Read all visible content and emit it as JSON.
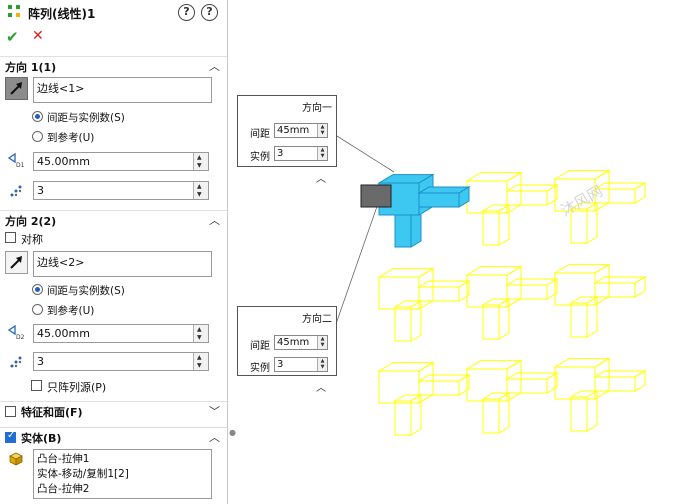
{
  "titlebar": {
    "title": "阵列(线性)1",
    "help1": "?",
    "help2": "?"
  },
  "actions": {
    "ok": "✔",
    "cancel": "✕"
  },
  "direction1": {
    "header": "方向 1(1)",
    "edge": "边线<1>",
    "opt_spacing": "间距与实例数(S)",
    "opt_reference": "到参考(U)",
    "spacing_value": "45.00mm",
    "count_value": "3"
  },
  "direction2": {
    "header": "方向 2(2)",
    "symmetric": "对称",
    "edge": "边线<2>",
    "opt_spacing": "间距与实例数(S)",
    "opt_reference": "到参考(U)",
    "spacing_value": "45.00mm",
    "count_value": "3",
    "seed_only": "只阵列源(P)"
  },
  "features_section": {
    "header": "特征和面(F)"
  },
  "bodies_section": {
    "header": "实体(B)",
    "items": [
      "凸台-拉伸1",
      "实体-移动/复制1[2]",
      "凸台-拉伸2"
    ]
  },
  "callout1": {
    "title": "方向一",
    "spacing_label": "间距",
    "spacing_value": "45mm",
    "count_label": "实例",
    "count_value": "3"
  },
  "callout2": {
    "title": "方向二",
    "spacing_label": "间距",
    "spacing_value": "45mm",
    "count_label": "实例",
    "count_value": "3"
  },
  "colors": {
    "accent": "#1f5fbf",
    "ok": "#2c9e2c",
    "cancel": "#d81e1e",
    "preview": "#ffff00",
    "selected": "#3cc8f0"
  },
  "icons": {
    "title": "linear-pattern-icon",
    "dir1": "arrow-direction-icon",
    "dir2": "arrow-direction-icon",
    "spacing": "spacing-d1-icon",
    "count": "instances-icon",
    "body": "solid-body-icon"
  },
  "watermark": "沐风网"
}
